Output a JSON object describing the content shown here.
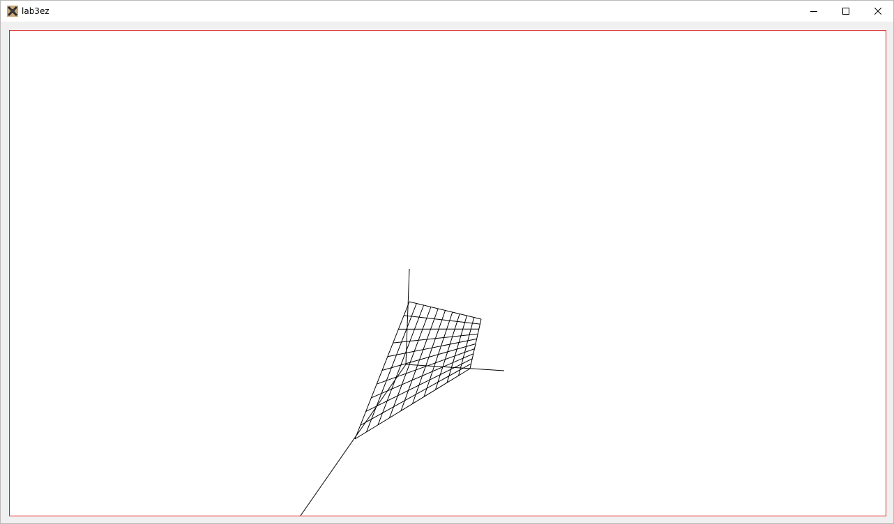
{
  "window": {
    "title": "lab3ez",
    "icon": "app-icon",
    "controls": {
      "minimize_icon": "minimize-icon",
      "maximize_icon": "maximize-icon",
      "close_icon": "close-icon"
    }
  },
  "canvas": {
    "border_color": "#e11b1b",
    "background": "#ffffff",
    "stroke_color": "#000000"
  }
}
